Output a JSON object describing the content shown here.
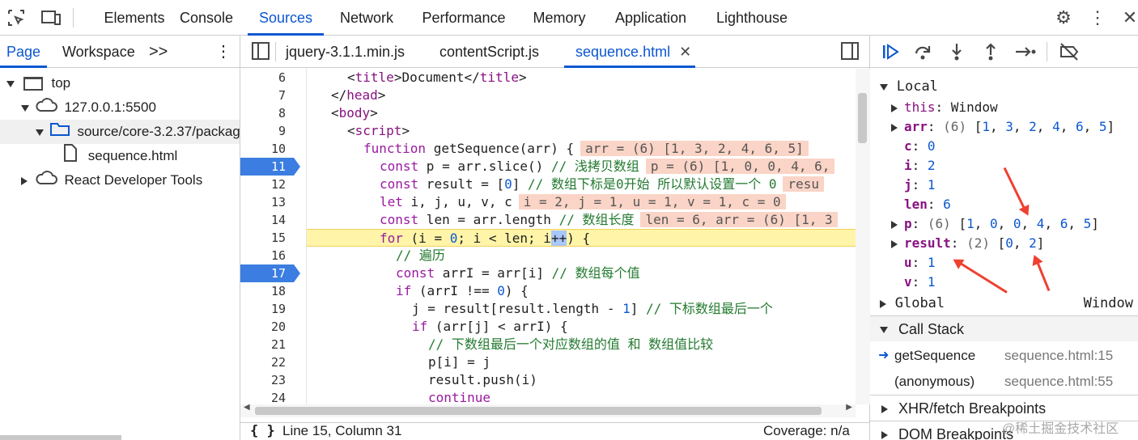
{
  "toolbar": {
    "tabs": [
      "Elements",
      "Console",
      "Sources",
      "Network",
      "Performance",
      "Memory",
      "Application",
      "Lighthouse"
    ],
    "active_tab": "Sources",
    "icons": [
      "select-element-icon",
      "device-toolbar-icon",
      "settings-icon",
      "more-vert-icon",
      "close-icon"
    ]
  },
  "navigator": {
    "tabs": [
      "Page",
      "Workspace"
    ],
    "more": ">>",
    "tree": [
      {
        "label": "top"
      },
      {
        "label": "127.0.0.1:5500"
      },
      {
        "label": "source/core-3.2.37/packag"
      },
      {
        "label": "sequence.html"
      },
      {
        "label": "React Developer Tools"
      }
    ]
  },
  "editor": {
    "tabs": [
      "jquery-3.1.1.min.js",
      "contentScript.js",
      "sequence.html"
    ],
    "active_tab": "sequence.html",
    "line_numbers": [
      "6",
      "7",
      "8",
      "9",
      "10",
      "11",
      "12",
      "13",
      "14",
      "15",
      "16",
      "17",
      "18",
      "19",
      "20",
      "21",
      "22",
      "23",
      "24"
    ],
    "breakpoints": [
      "11",
      "17"
    ],
    "current_line": "15",
    "inline_values": {
      "l10": "arr = (6) [1, 3, 2, 4, 6, 5]",
      "l11": "p = (6) [1, 0, 0, 4, 6,",
      "l12": "resu",
      "l13": "i = 2, j = 1, u = 1, v = 1, c = 0",
      "l14": "len = 6, arr = (6) [1, 3"
    },
    "status": {
      "position": "Line 15, Column 31",
      "coverage": "Coverage: n/a",
      "format_icon": "{ }"
    }
  },
  "debugger": {
    "scope_local": "Local",
    "vars": [
      {
        "name": "this",
        "value": "Window"
      },
      {
        "name": "arr",
        "value": "(6) [1, 3, 2, 4, 6, 5]"
      },
      {
        "name": "c",
        "value": "0"
      },
      {
        "name": "i",
        "value": "2"
      },
      {
        "name": "j",
        "value": "1"
      },
      {
        "name": "len",
        "value": "6"
      },
      {
        "name": "p",
        "value": "(6) [1, 0, 0, 4, 6, 5]"
      },
      {
        "name": "result",
        "value": "(2) [0, 2]"
      },
      {
        "name": "u",
        "value": "1"
      },
      {
        "name": "v",
        "value": "1"
      }
    ],
    "global_label": "Global",
    "global_value": "Window",
    "callstack_title": "Call Stack",
    "callstack": [
      {
        "fn": "getSequence",
        "loc": "sequence.html:15"
      },
      {
        "fn": "(anonymous)",
        "loc": "sequence.html:55"
      }
    ],
    "xhr": "XHR/fetch Breakpoints",
    "dom": "DOM Breakpoints"
  },
  "watermark": "@稀土掘金技术社区",
  "colors": {
    "accent": "#0b57d0",
    "current_line": "#fff4a8",
    "breakpoint": "#3b7de0",
    "inline_value_bg": "#fad4c6",
    "annotation": "#f04030"
  }
}
